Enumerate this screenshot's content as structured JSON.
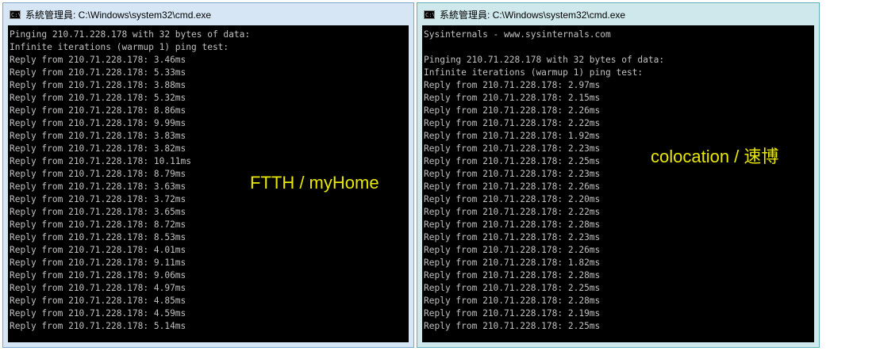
{
  "left_window": {
    "title": "系統管理員: C:\\Windows\\system32\\cmd.exe",
    "lines": [
      "Pinging 210.71.228.178 with 32 bytes of data:",
      "Infinite iterations (warmup 1) ping test:",
      "Reply from 210.71.228.178: 3.46ms",
      "Reply from 210.71.228.178: 5.33ms",
      "Reply from 210.71.228.178: 3.88ms",
      "Reply from 210.71.228.178: 5.32ms",
      "Reply from 210.71.228.178: 8.86ms",
      "Reply from 210.71.228.178: 9.99ms",
      "Reply from 210.71.228.178: 3.83ms",
      "Reply from 210.71.228.178: 3.82ms",
      "Reply from 210.71.228.178: 10.11ms",
      "Reply from 210.71.228.178: 8.79ms",
      "Reply from 210.71.228.178: 3.63ms",
      "Reply from 210.71.228.178: 3.72ms",
      "Reply from 210.71.228.178: 3.65ms",
      "Reply from 210.71.228.178: 8.72ms",
      "Reply from 210.71.228.178: 8.53ms",
      "Reply from 210.71.228.178: 4.01ms",
      "Reply from 210.71.228.178: 9.11ms",
      "Reply from 210.71.228.178: 9.06ms",
      "Reply from 210.71.228.178: 4.97ms",
      "Reply from 210.71.228.178: 4.85ms",
      "Reply from 210.71.228.178: 4.59ms",
      "Reply from 210.71.228.178: 5.14ms"
    ],
    "annotation": "FTTH / myHome"
  },
  "right_window": {
    "title": "系統管理員: C:\\Windows\\system32\\cmd.exe",
    "lines": [
      "Sysinternals - www.sysinternals.com",
      "",
      "Pinging 210.71.228.178 with 32 bytes of data:",
      "Infinite iterations (warmup 1) ping test:",
      "Reply from 210.71.228.178: 2.97ms",
      "Reply from 210.71.228.178: 2.15ms",
      "Reply from 210.71.228.178: 2.26ms",
      "Reply from 210.71.228.178: 2.22ms",
      "Reply from 210.71.228.178: 1.92ms",
      "Reply from 210.71.228.178: 2.23ms",
      "Reply from 210.71.228.178: 2.25ms",
      "Reply from 210.71.228.178: 2.23ms",
      "Reply from 210.71.228.178: 2.26ms",
      "Reply from 210.71.228.178: 2.20ms",
      "Reply from 210.71.228.178: 2.22ms",
      "Reply from 210.71.228.178: 2.28ms",
      "Reply from 210.71.228.178: 2.23ms",
      "Reply from 210.71.228.178: 2.26ms",
      "Reply from 210.71.228.178: 1.82ms",
      "Reply from 210.71.228.178: 2.28ms",
      "Reply from 210.71.228.178: 2.25ms",
      "Reply from 210.71.228.178: 2.28ms",
      "Reply from 210.71.228.178: 2.19ms",
      "Reply from 210.71.228.178: 2.25ms"
    ],
    "annotation": "colocation / 速博"
  },
  "colors": {
    "console_text": "#c0c0c0",
    "console_background": "#000000",
    "annotation": "#e8e800"
  },
  "icons": {
    "window_icon": "cmd-icon"
  }
}
